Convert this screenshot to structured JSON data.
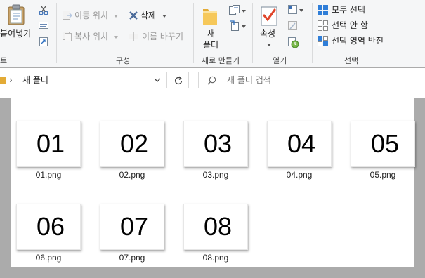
{
  "ribbon": {
    "clipboard": {
      "paste_label": "붙여넣기",
      "group_label": "트"
    },
    "organize": {
      "move_to": "이동 위치",
      "copy_to": "복사 위치",
      "delete": "삭제",
      "rename": "이름 바꾸기",
      "group_label": "구성"
    },
    "new": {
      "new_folder_line1": "새",
      "new_folder_line2": "폴더",
      "group_label": "새로 만들기"
    },
    "open": {
      "properties": "속성",
      "group_label": "열기"
    },
    "select": {
      "select_all": "모두 선택",
      "select_none": "선택 안 함",
      "invert_selection": "선택 영역 반전",
      "group_label": "선택"
    }
  },
  "address": {
    "path_separator": "›",
    "current_folder": "새 폴더"
  },
  "search": {
    "placeholder": "새 폴더 검색"
  },
  "files": [
    {
      "thumb": "01",
      "name": "01.png"
    },
    {
      "thumb": "02",
      "name": "02.png"
    },
    {
      "thumb": "03",
      "name": "03.png"
    },
    {
      "thumb": "04",
      "name": "04.png"
    },
    {
      "thumb": "05",
      "name": "05.png"
    },
    {
      "thumb": "06",
      "name": "06.png"
    },
    {
      "thumb": "07",
      "name": "07.png"
    },
    {
      "thumb": "08",
      "name": "08.png"
    }
  ],
  "icons": {
    "cut": "scissors-icon",
    "copy_path": "copy-path-icon",
    "paste_shortcut": "paste-shortcut-icon",
    "move": "move-to-icon",
    "copy": "copy-to-icon",
    "delete": "delete-x-icon",
    "rename": "rename-icon",
    "new_folder": "folder-icon",
    "new_item": "new-item-icon",
    "easy_access": "easy-access-icon",
    "properties": "properties-check-icon",
    "open": "open-icon",
    "edit": "edit-icon",
    "history": "history-icon",
    "select_all": "select-all-icon",
    "select_none": "select-none-icon",
    "invert": "invert-selection-icon",
    "refresh": "refresh-icon",
    "search": "search-icon",
    "dropdown": "chevron-down-icon"
  },
  "colors": {
    "accent_blue": "#1e6fc8",
    "delete_x": "#4a6a9a",
    "check_red": "#e0452b",
    "folder_yellow": "#f2c14e"
  }
}
